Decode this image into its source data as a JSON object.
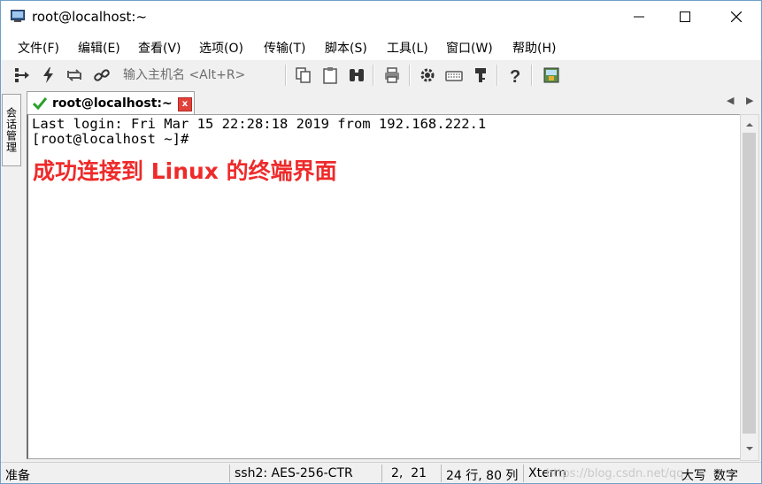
{
  "window": {
    "title": "root@localhost:~"
  },
  "menu": {
    "items": [
      "文件(F)",
      "编辑(E)",
      "查看(V)",
      "选项(O)",
      "传输(T)",
      "脚本(S)",
      "工具(L)",
      "窗口(W)",
      "帮助(H)"
    ]
  },
  "toolbar": {
    "host_placeholder": "输入主机名 <Alt+R>",
    "icons": [
      "connect-tree-icon",
      "lightning-icon",
      "reconnect-icon",
      "link-icon",
      "copy-icon",
      "paste-icon",
      "find-icon",
      "print-icon",
      "gear-icon",
      "keyboard-icon",
      "key-icon",
      "help-icon",
      "script-icon"
    ]
  },
  "session_manager": {
    "label": "会话管理"
  },
  "tabs": [
    {
      "label": "root@localhost:~",
      "close": "x"
    }
  ],
  "terminal": {
    "lines": [
      "Last login: Fri Mar 15 22:28:18 2019 from 192.168.222.1",
      "[root@localhost ~]#"
    ],
    "annotation": "成功连接到 Linux 的终端界面"
  },
  "status": {
    "ready": "准备",
    "cipher": "ssh2: AES-256-CTR",
    "cursor": "2,  21",
    "size": "24 行, 80 列",
    "term": "Xterm",
    "watermark": "https://blog.csdn.net/qq_",
    "caps": "大写",
    "num": "数字"
  },
  "colors": {
    "accent_border": "#6f9fc9",
    "annotation": "#ee2a2a",
    "tab_check": "#2aa02a",
    "tab_close": "#e0423a"
  }
}
